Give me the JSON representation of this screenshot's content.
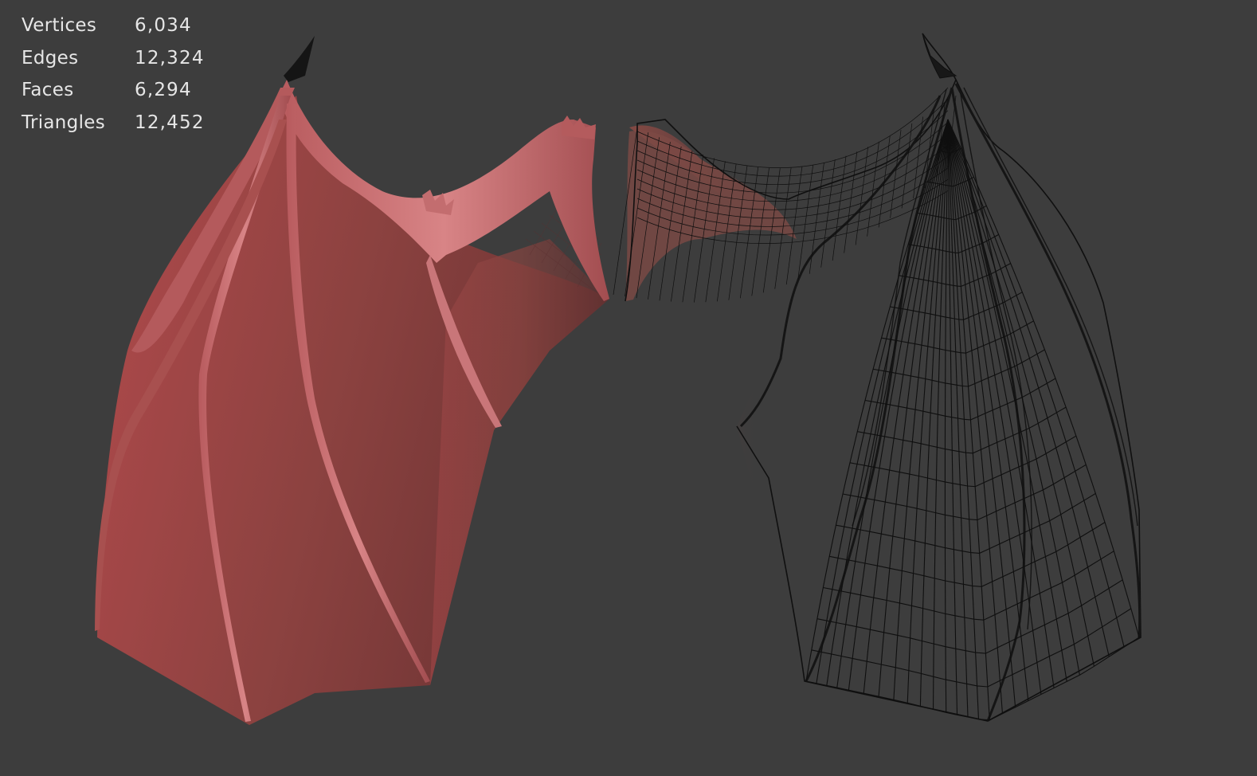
{
  "overlay": {
    "stats": [
      {
        "label": "Vertices",
        "value": "6,034"
      },
      {
        "label": "Edges",
        "value": "12,324"
      },
      {
        "label": "Faces",
        "value": "6,294"
      },
      {
        "label": "Triangles",
        "value": "12,452"
      }
    ]
  },
  "viewport": {
    "background": "#3d3d3d",
    "left_object": {
      "shading": "solid",
      "color": "#8a3f3f"
    },
    "right_object": {
      "shading": "wireframe",
      "color": "#111111"
    }
  }
}
